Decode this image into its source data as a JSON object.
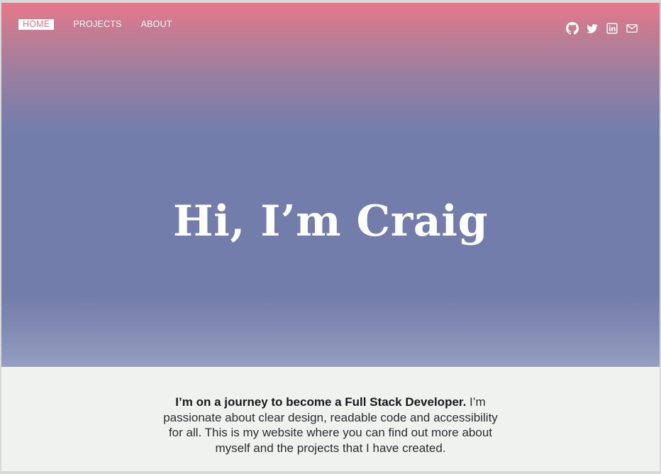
{
  "nav": {
    "items": [
      {
        "label": "HOME",
        "active": true
      },
      {
        "label": "PROJECTS",
        "active": false
      },
      {
        "label": "ABOUT",
        "active": false
      }
    ]
  },
  "social": {
    "icons": [
      "github-icon",
      "twitter-icon",
      "linkedin-icon",
      "mail-icon"
    ]
  },
  "hero": {
    "title": "Hi, I’m Craig"
  },
  "intro": {
    "lead": "I’m on a journey to become a Full Stack Developer.",
    "body": " I’m passionate about clear design, readable code and accessibility for all.  This is my website where you can find out more about myself and the projects that I have created."
  },
  "colors": {
    "accent": "#e8778a",
    "hero_mid": "#737dab",
    "background": "#eff2ee",
    "text": "#2b2d33"
  }
}
